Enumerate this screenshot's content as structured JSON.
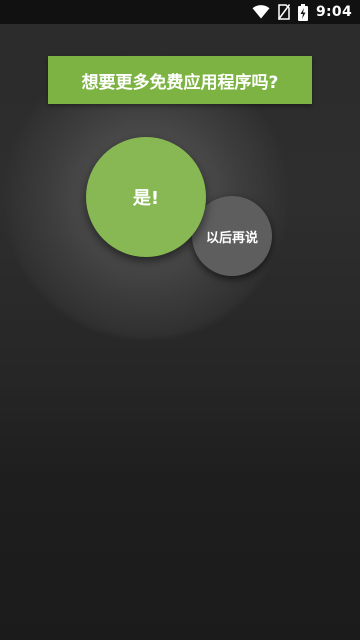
{
  "status_bar": {
    "time": "9:04",
    "icons": [
      "wifi-icon",
      "no-sim-icon",
      "battery-charging-icon"
    ]
  },
  "dialog": {
    "title": "想要更多免费应用程序吗?",
    "yes_label": "是!",
    "later_label": "以后再说"
  },
  "colors": {
    "accent": "#7cb342",
    "yes_button": "#88b854",
    "later_button": "#5e5e5e",
    "background": "#262626"
  }
}
